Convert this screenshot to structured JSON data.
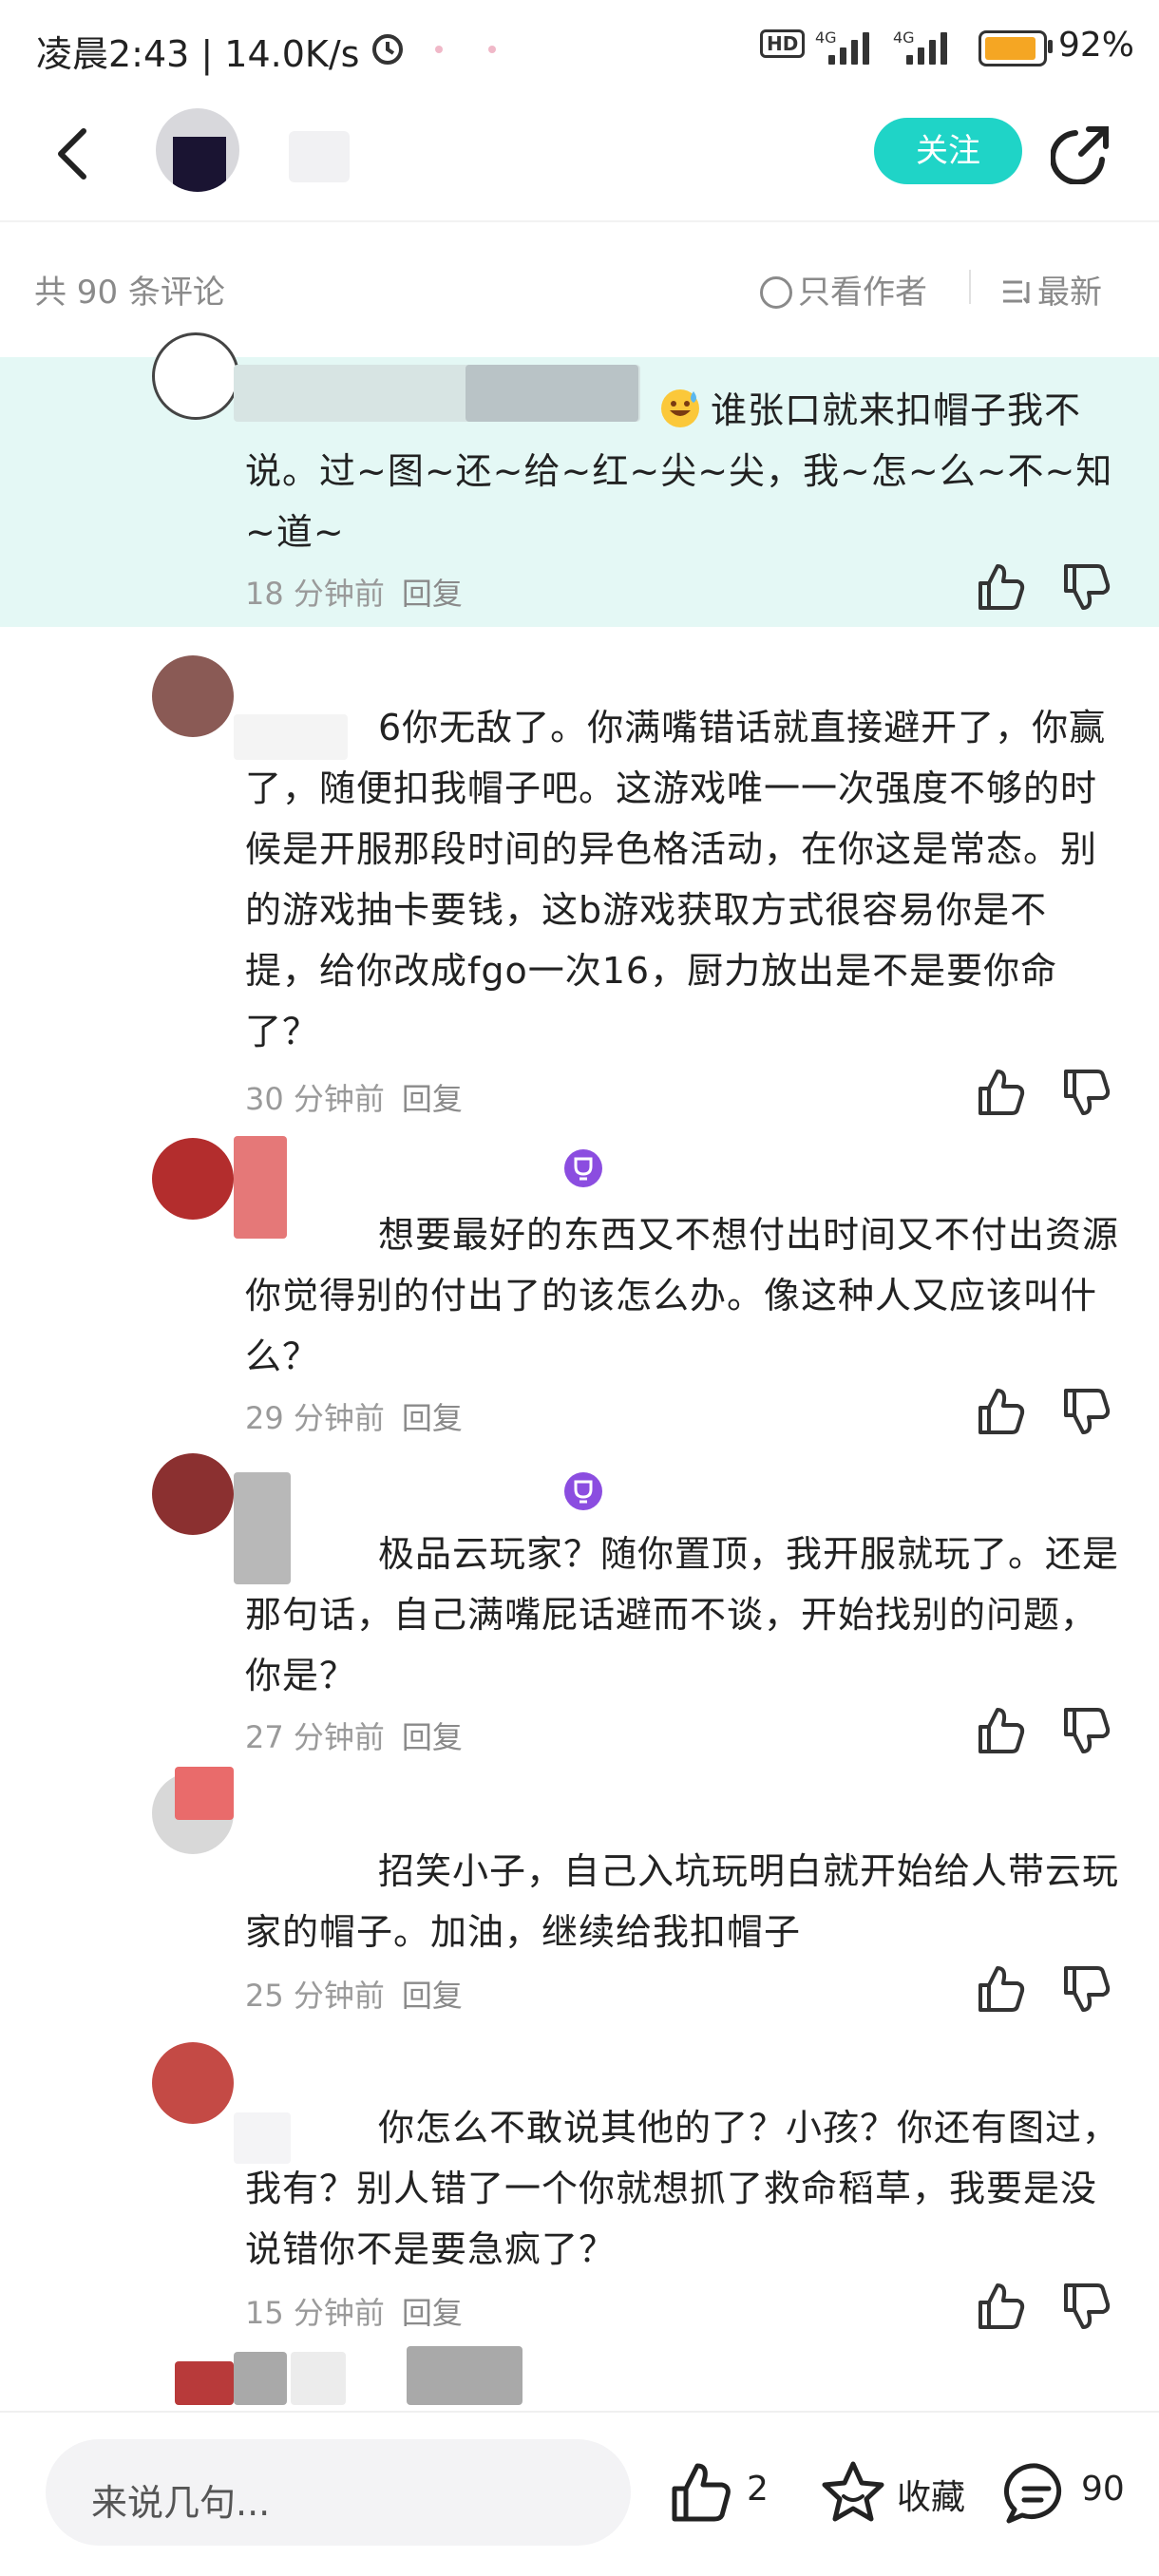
{
  "status_bar": {
    "time": "凌晨2:43 | 14.0K/s",
    "hd": "HD",
    "net1": "4G",
    "net2": "4G",
    "battery_percent": 92,
    "battery_text": "92%"
  },
  "header": {
    "follow_label": "关注"
  },
  "toolbar": {
    "count": "共 90 条评论",
    "only_author": "只看作者",
    "sort": "最新"
  },
  "comments": [
    {
      "text": "谁张口就来扣帽子我不说。过~图~还~给~红~尖~尖，我~怎~么~不~知~道~",
      "time": "18 分钟前",
      "reply": "回复"
    },
    {
      "text": "6你无敌了。你满嘴错话就直接避开了，你赢了，随便扣我帽子吧。这游戏唯一一次强度不够的时候是开服那段时间的异色格活动，在你这是常态。别的游戏抽卡要钱，这b游戏获取方式很容易你是不提，给你改成fgo一次16，厨力放出是不是要你命了？",
      "time": "30 分钟前",
      "reply": "回复"
    },
    {
      "text": "想要最好的东西又不想付出时间又不付出资源你觉得别的付出了的该怎么办。像这种人又应该叫什么？",
      "time": "29 分钟前",
      "reply": "回复"
    },
    {
      "text": "极品云玩家？随你置顶，我开服就玩了。还是那句话，自己满嘴屁话避而不谈，开始找别的问题，你是？",
      "time": "27 分钟前",
      "reply": "回复"
    },
    {
      "text": "招笑小子，自己入坑玩明白就开始给人带云玩家的帽子。加油，继续给我扣帽子",
      "time": "25 分钟前",
      "reply": "回复"
    },
    {
      "text": "你怎么不敢说其他的了？小孩？你还有图过，我有？别人错了一个你就想抓了救命稻草，我要是没说错你不是要急疯了？",
      "time": "15 分钟前",
      "reply": "回复"
    }
  ],
  "bottom_bar": {
    "input_placeholder": "来说几句...",
    "like_count": "2",
    "favorite_label": "收藏",
    "comment_count": "90"
  }
}
